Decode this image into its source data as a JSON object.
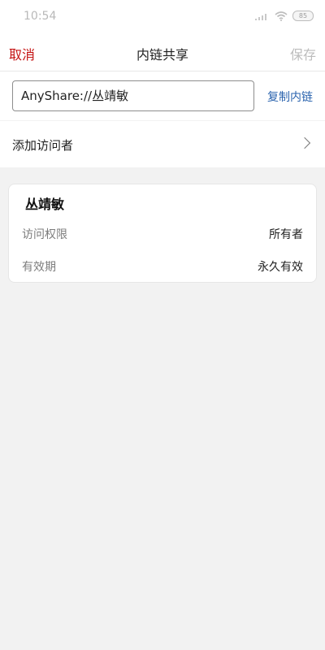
{
  "status_bar": {
    "time": "10:54",
    "battery": "85",
    "icons": [
      "signal-icon",
      "wifi-icon",
      "battery-icon"
    ]
  },
  "nav": {
    "cancel": "取消",
    "title": "内链共享",
    "save": "保存"
  },
  "link": {
    "value": "AnyShare://丛靖敏",
    "copy_label": "复制内链"
  },
  "visitor": {
    "add_label": "添加访问者"
  },
  "card": {
    "name": "丛靖敏",
    "rows": [
      {
        "label": "访问权限",
        "value": "所有者"
      },
      {
        "label": "有效期",
        "value": "永久有效"
      }
    ]
  },
  "colors": {
    "accent_red": "#c41212",
    "link_blue": "#2a63ae",
    "background": "#f2f2f2"
  }
}
